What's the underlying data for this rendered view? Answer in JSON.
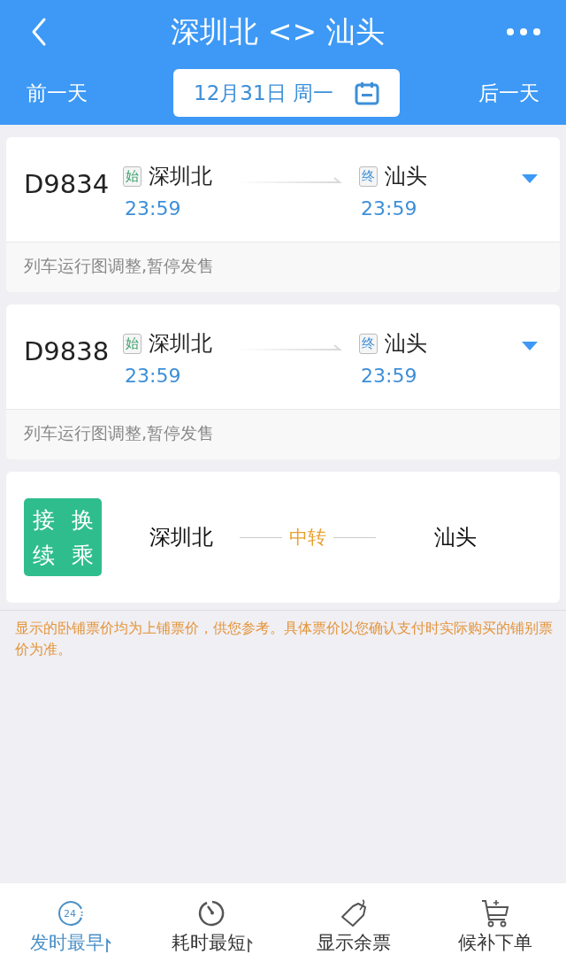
{
  "header": {
    "title": "深圳北 <> 汕头",
    "prev_day": "前一天",
    "date": "12月31日 周一",
    "next_day": "后一天"
  },
  "trains": [
    {
      "number": "D9834",
      "from_tag": "始",
      "from": "深圳北",
      "depart": "23:59",
      "to_tag": "终",
      "to": "汕头",
      "arrive": "23:59",
      "notice": "列车运行图调整,暂停发售",
      "expanded": false
    },
    {
      "number": "D9838",
      "from_tag": "始",
      "from": "深圳北",
      "depart": "23:59",
      "to_tag": "终",
      "to": "汕头",
      "arrive": "23:59",
      "notice": "列车运行图调整,暂停发售",
      "expanded": false
    }
  ],
  "transfer": {
    "badge": [
      "接",
      "换",
      "续",
      "乘"
    ],
    "from": "深圳北",
    "via": "中转",
    "to": "汕头"
  },
  "note": "显示的卧铺票价均为上铺票价，供您参考。具体票价以您确认支付时实际购买的铺别票价为准。",
  "bottom_tabs": [
    {
      "kind": "clock24",
      "icon_text": "24",
      "label": "发时最早",
      "selected": true,
      "sortable": true
    },
    {
      "kind": "timer",
      "label": "耗时最短",
      "selected": false,
      "sortable": true
    },
    {
      "kind": "tag",
      "label": "显示余票",
      "selected": false,
      "sortable": false
    },
    {
      "kind": "cart",
      "label": "候补下单",
      "selected": false,
      "sortable": false
    }
  ]
}
